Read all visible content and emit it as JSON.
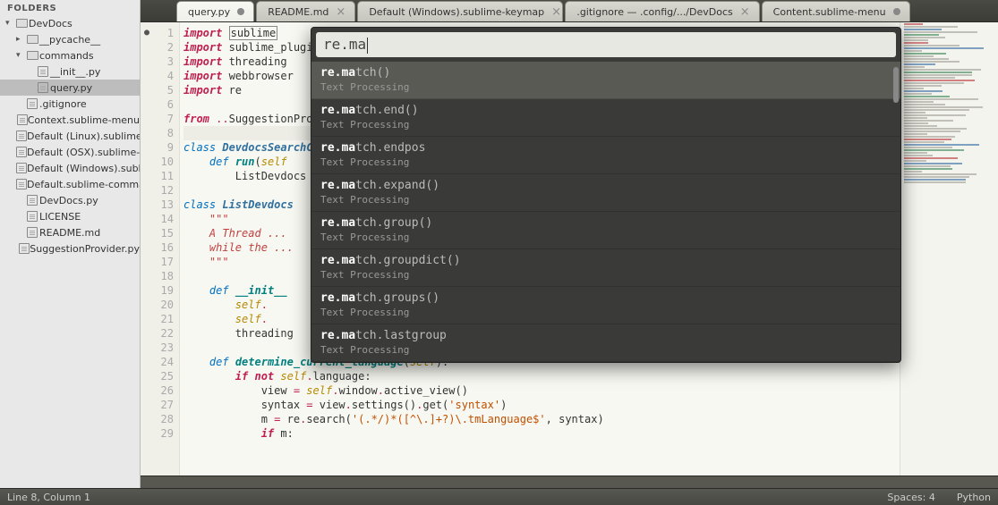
{
  "sidebar": {
    "header": "FOLDERS",
    "items": [
      {
        "type": "folder",
        "name": "DevDocs",
        "open": true,
        "indent": 0,
        "arrow": "▾"
      },
      {
        "type": "folder",
        "name": "__pycache__",
        "open": false,
        "indent": 1,
        "arrow": "▸"
      },
      {
        "type": "folder",
        "name": "commands",
        "open": true,
        "indent": 1,
        "arrow": "▾"
      },
      {
        "type": "file",
        "name": "__init__.py",
        "indent": 2
      },
      {
        "type": "file",
        "name": "query.py",
        "indent": 2,
        "selected": true
      },
      {
        "type": "file",
        "name": ".gitignore",
        "indent": 1
      },
      {
        "type": "file",
        "name": "Context.sublime-menu",
        "indent": 1
      },
      {
        "type": "file",
        "name": "Default (Linux).sublime-keymap",
        "indent": 1
      },
      {
        "type": "file",
        "name": "Default (OSX).sublime-keymap",
        "indent": 1
      },
      {
        "type": "file",
        "name": "Default (Windows).sublime-keymap",
        "indent": 1
      },
      {
        "type": "file",
        "name": "Default.sublime-commands",
        "indent": 1
      },
      {
        "type": "file",
        "name": "DevDocs.py",
        "indent": 1
      },
      {
        "type": "file",
        "name": "LICENSE",
        "indent": 1
      },
      {
        "type": "file",
        "name": "README.md",
        "indent": 1
      },
      {
        "type": "file",
        "name": "SuggestionProvider.py",
        "indent": 1
      }
    ]
  },
  "tabs": [
    {
      "label": "query.py",
      "active": true,
      "dirty": true
    },
    {
      "label": "README.md",
      "dirty": false
    },
    {
      "label": "Default (Windows).sublime-keymap",
      "dirty": false
    },
    {
      "label": ".gitignore — .config/.../DevDocs",
      "dirty": false
    },
    {
      "label": "Content.sublime-menu",
      "dirty": true
    }
  ],
  "code_lines": [
    {
      "n": 1,
      "html": "<span class='kw'>import</span> <span class='box'>sublime</span>",
      "mark": true
    },
    {
      "n": 2,
      "html": "<span class='kw'>import</span> sublime_plugin"
    },
    {
      "n": 3,
      "html": "<span class='kw'>import</span> threading"
    },
    {
      "n": 4,
      "html": "<span class='kw'>import</span> webbrowser"
    },
    {
      "n": 5,
      "html": "<span class='kw'>import</span> re"
    },
    {
      "n": 6,
      "html": ""
    },
    {
      "n": 7,
      "html": "<span class='kw'>from</span> <span class='op'>..</span>SuggestionProvider"
    },
    {
      "n": 8,
      "html": "",
      "hl": true
    },
    {
      "n": 9,
      "html": "<span class='kw2'>class</span> <span class='cls'>DevdocsSearchCommand</span>"
    },
    {
      "n": 10,
      "html": "    <span class='kw2'>def</span> <span class='fn'>run</span>(<span class='self'>self</span>"
    },
    {
      "n": 11,
      "html": "        ListDevdocs"
    },
    {
      "n": 12,
      "html": ""
    },
    {
      "n": 13,
      "html": "<span class='kw2'>class</span> <span class='cls'>ListDevdocs</span>"
    },
    {
      "n": 14,
      "html": "    <span class='doc'>\"\"\"</span>"
    },
    {
      "n": 15,
      "html": "    <span class='doc'>A Thread ...</span>"
    },
    {
      "n": 16,
      "html": "    <span class='doc'>while the ...</span>"
    },
    {
      "n": 17,
      "html": "    <span class='doc'>\"\"\"</span>"
    },
    {
      "n": 18,
      "html": ""
    },
    {
      "n": 19,
      "html": "    <span class='kw2'>def</span> <span class='fn'>__init__</span>"
    },
    {
      "n": 20,
      "html": "        <span class='self'>self</span><span class='op'>.</span>"
    },
    {
      "n": 21,
      "html": "        <span class='self'>self</span><span class='op'>.</span>"
    },
    {
      "n": 22,
      "html": "        threading"
    },
    {
      "n": 23,
      "html": ""
    },
    {
      "n": 24,
      "html": "    <span class='kw2'>def</span> <span class='fn'>determine_current_language</span>(<span class='self'>self</span>):"
    },
    {
      "n": 25,
      "html": "        <span class='kw'>if</span> <span class='kw'>not</span> <span class='self'>self</span><span class='op'>.</span>language:"
    },
    {
      "n": 26,
      "html": "            view <span class='op'>=</span> <span class='self'>self</span><span class='op'>.</span>window<span class='op'>.</span>active_view()"
    },
    {
      "n": 27,
      "html": "            syntax <span class='op'>=</span> view<span class='op'>.</span>settings()<span class='op'>.</span>get(<span class='str'>'syntax'</span>)"
    },
    {
      "n": 28,
      "html": "            m <span class='op'>=</span> re<span class='op'>.</span>search(<span class='str'>'(.*/)*([^\\.]+?)\\.tmLanguage$'</span>, syntax)"
    },
    {
      "n": 29,
      "html": "            <span class='kw'>if</span> m:"
    }
  ],
  "popup": {
    "query": "re.ma",
    "items": [
      {
        "title": "re.match()",
        "sub": "Text Processing",
        "selected": true
      },
      {
        "title": "re.match.end()",
        "sub": "Text Processing"
      },
      {
        "title": "re.match.endpos",
        "sub": "Text Processing"
      },
      {
        "title": "re.match.expand()",
        "sub": "Text Processing"
      },
      {
        "title": "re.match.group()",
        "sub": "Text Processing"
      },
      {
        "title": "re.match.groupdict()",
        "sub": "Text Processing"
      },
      {
        "title": "re.match.groups()",
        "sub": "Text Processing"
      },
      {
        "title": "re.match.lastgroup",
        "sub": "Text Processing"
      }
    ],
    "match_prefix": "re.ma"
  },
  "status": {
    "left": "Line 8, Column 1",
    "spaces": "Spaces: 4",
    "syntax": "Python"
  }
}
